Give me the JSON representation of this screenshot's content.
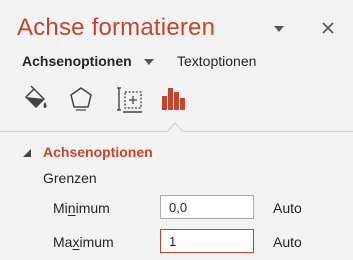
{
  "panel": {
    "title": "Achse formatieren"
  },
  "tabs": {
    "options_label": "Achsenoptionen",
    "text_label": "Textoptionen"
  },
  "icons": [
    "paint-bucket-icon",
    "pentagon-icon",
    "size-properties-icon",
    "bar-chart-icon"
  ],
  "section": {
    "label": "Achsenoptionen",
    "subheading": "Grenzen"
  },
  "bounds": {
    "minimum": {
      "label_pre": "Mi",
      "label_underline": "n",
      "label_post": "imum",
      "value": "0,0",
      "auto": "Auto"
    },
    "maximum": {
      "label_pre": "Ma",
      "label_underline": "x",
      "label_post": "imum",
      "value": "1",
      "auto": "Auto"
    }
  },
  "colors": {
    "accent": "#c4452b",
    "background": "#f3f3f3",
    "text": "#262626"
  }
}
